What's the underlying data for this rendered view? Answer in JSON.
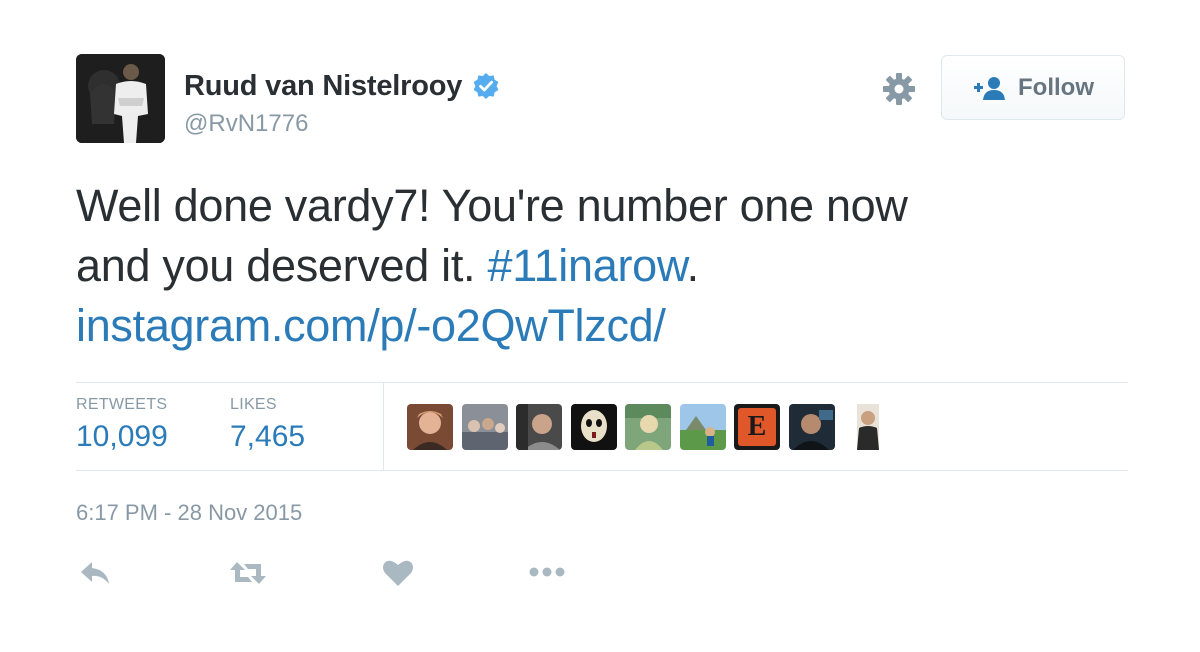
{
  "user": {
    "display_name": "Ruud van Nistelrooy",
    "handle": "@RvN1776",
    "verified": true
  },
  "header": {
    "follow_label": "Follow",
    "settings_icon": "gear-icon",
    "follow_icon": "add-user-icon"
  },
  "tweet": {
    "text_line1": "Well done vardy7! You're number one now",
    "text_line2_prefix": "and you deserved it. ",
    "hashtag": "#11inarow",
    "text_line2_suffix": ".",
    "link": "instagram.com/p/-o2QwTlzcd/"
  },
  "stats": {
    "retweets_label": "RETWEETS",
    "retweets_value": "10,099",
    "likes_label": "LIKES",
    "likes_value": "7,465"
  },
  "likers": [
    {
      "name": "liker-avatar-1"
    },
    {
      "name": "liker-avatar-2"
    },
    {
      "name": "liker-avatar-3"
    },
    {
      "name": "liker-avatar-4"
    },
    {
      "name": "liker-avatar-5"
    },
    {
      "name": "liker-avatar-6"
    },
    {
      "name": "liker-avatar-7",
      "letter": "E"
    },
    {
      "name": "liker-avatar-8"
    },
    {
      "name": "liker-avatar-9"
    }
  ],
  "timestamp": "6:17 PM - 28 Nov 2015",
  "actions": [
    "reply-icon",
    "retweet-icon",
    "like-icon",
    "more-icon"
  ],
  "colors": {
    "link": "#2b7bb9",
    "muted": "#8899a6",
    "text": "#292f33",
    "verified": "#55acee",
    "action_icon": "#aab8c2"
  }
}
